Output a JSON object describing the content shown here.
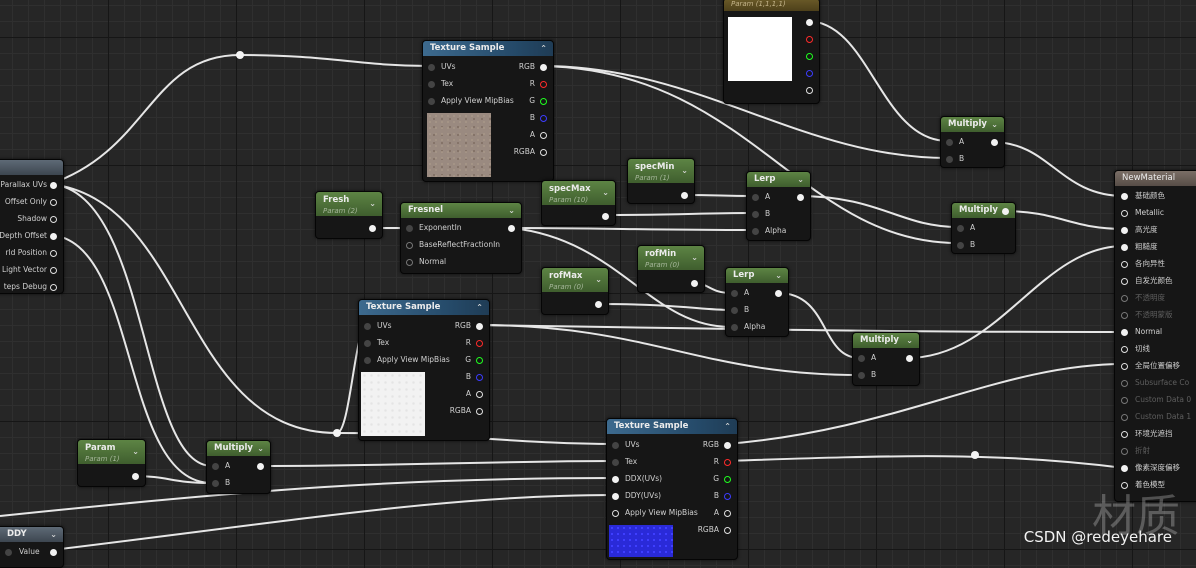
{
  "nodes": {
    "left_partial": {
      "pins": [
        "Parallax UVs",
        "Offset Only",
        "Shadow",
        "Depth Offset",
        "rld Position",
        "Light Vector",
        "teps Debug"
      ]
    },
    "tex_sample_1": {
      "title": "Texture Sample",
      "inputs": [
        "UVs",
        "Tex",
        "Apply View MipBias"
      ],
      "outputs": [
        "RGB",
        "R",
        "G",
        "B",
        "A",
        "RGBA"
      ]
    },
    "tex_sample_2": {
      "title": "Texture Sample",
      "inputs": [
        "UVs",
        "Tex",
        "Apply View MipBias"
      ],
      "outputs": [
        "RGB",
        "R",
        "G",
        "B",
        "A",
        "RGBA"
      ]
    },
    "tex_sample_3": {
      "title": "Texture Sample",
      "inputs": [
        "UVs",
        "Tex",
        "DDX(UVs)",
        "DDY(UVs)",
        "Apply View MipBias"
      ],
      "outputs": [
        "RGB",
        "R",
        "G",
        "B",
        "A",
        "RGBA"
      ]
    },
    "param_color": {
      "sub": "Param (1,1,1,1)"
    },
    "multiply_1": {
      "title": "Multiply",
      "inputs": [
        "A",
        "B"
      ]
    },
    "multiply_2": {
      "title": "Multiply",
      "inputs": [
        "A",
        "B"
      ]
    },
    "multiply_3": {
      "title": "Multiply",
      "inputs": [
        "A",
        "B"
      ]
    },
    "multiply_4": {
      "title": "Multiply",
      "inputs": [
        "A",
        "B"
      ]
    },
    "spec_min": {
      "title": "specMin",
      "sub": "Param (1)"
    },
    "spec_max": {
      "title": "specMax",
      "sub": "Param (10)"
    },
    "fresh": {
      "title": "Fresh",
      "sub": "Param (2)"
    },
    "fresnel": {
      "title": "Fresnel",
      "inputs": [
        "ExponentIn",
        "BaseReflectFractionIn",
        "Normal"
      ]
    },
    "lerp_1": {
      "title": "Lerp",
      "inputs": [
        "A",
        "B",
        "Alpha"
      ]
    },
    "lerp_2": {
      "title": "Lerp",
      "inputs": [
        "A",
        "B",
        "Alpha"
      ]
    },
    "rof_min": {
      "title": "rofMin",
      "sub": "Param (0)"
    },
    "rof_max": {
      "title": "rofMax",
      "sub": "Param (0)"
    },
    "param_1": {
      "title": "Param",
      "sub": "Param (1)"
    },
    "ddy": {
      "title": "DDY",
      "pin": "Value"
    },
    "new_material": {
      "title": "NewMaterial",
      "inputs": [
        "基础颜色",
        "Metallic",
        "高光度",
        "粗糙度",
        "各向异性",
        "自发光颜色",
        "不透明度",
        "不透明蒙版",
        "Normal",
        "切线",
        "全局位置偏移",
        "Subsurface Co",
        "Custom Data 0",
        "Custom Data 1",
        "环境光遮挡",
        "折射",
        "像素深度偏移",
        "着色模型"
      ]
    }
  },
  "watermark": "材质",
  "credit": "CSDN @redeyehare",
  "colors": {
    "wire": "#e8e8e8",
    "tex1": "#9a8a80",
    "tex2": "#f2f2f2",
    "tex3": "#2a2ad8",
    "param_color": "#ffffff"
  }
}
